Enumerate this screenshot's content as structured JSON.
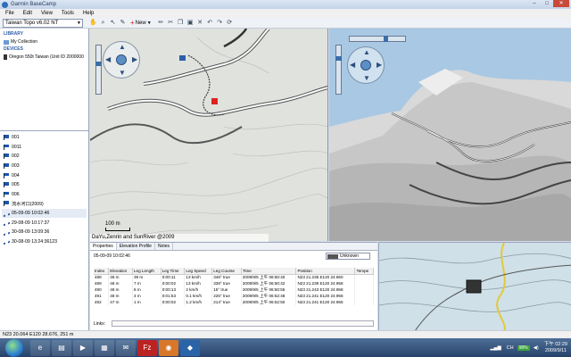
{
  "window": {
    "title": "Garmin BaseCamp",
    "min": "–",
    "max": "□",
    "close": "✕"
  },
  "menu": [
    "File",
    "Edit",
    "View",
    "Tools",
    "Help"
  ],
  "toolbar": {
    "map_product": "Taiwan Topo v6.02 NT",
    "new_label": "New",
    "icons": [
      "hand-icon",
      "magnifier-icon",
      "select-icon",
      "ruler-icon",
      "pencil-icon",
      "scissors-icon",
      "copy-icon",
      "paste-icon",
      "delete-icon",
      "undo-icon",
      "redo-icon",
      "rotate-icon"
    ]
  },
  "library": {
    "header": "LIBRARY",
    "collection": "My Collection",
    "devices_header": "DEVICES",
    "device": "Oregon 550t Taiwan (Unit ID 2000000"
  },
  "items": [
    {
      "type": "waypoint",
      "label": "001"
    },
    {
      "type": "waypoint",
      "label": "0011"
    },
    {
      "type": "waypoint",
      "label": "002"
    },
    {
      "type": "waypoint",
      "label": "003"
    },
    {
      "type": "waypoint",
      "label": "004"
    },
    {
      "type": "waypoint",
      "label": "005"
    },
    {
      "type": "waypoint",
      "label": "006"
    },
    {
      "type": "waypoint",
      "label": "流水河口(2009)"
    },
    {
      "type": "track",
      "label": "05-09-09 10:02:46"
    },
    {
      "type": "track",
      "label": "29-08-09 10:17:37"
    },
    {
      "type": "track",
      "label": "30-08-09 13:09:36"
    },
    {
      "type": "track",
      "label": "30-08-09 13:24:36123"
    }
  ],
  "map": {
    "scale_label": "100 m",
    "credits": "DaYu,Zenrin and SunRiver @2009"
  },
  "properties": {
    "tabs": [
      "Properties",
      "Elevation Profile",
      "Notes"
    ],
    "track_name": "05-09-09 10:02:46",
    "color_label": "Unknown",
    "columns": [
      "Index",
      "Elevation",
      "Leg Length",
      "Leg Time",
      "Leg Speed",
      "Leg Course",
      "Time",
      "Position",
      "Tempe"
    ],
    "rows": [
      [
        "488",
        "48 m",
        "39 m",
        "0:00:11",
        "13 km/h",
        "346° true",
        "2009/9/5 上午 06:50:40",
        "N23 21.235 E120 24.960",
        ""
      ],
      [
        "489",
        "48 m",
        "7 m",
        "0:00:02",
        "13 km/h",
        "338° true",
        "2009/9/5 上午 06:50:42",
        "N23 21.239 E120 24.958",
        ""
      ],
      [
        "490",
        "48 m",
        "8 m",
        "0:00:13",
        "2 km/h",
        "15° true",
        "2009/9/5 上午 06:50:55",
        "N23 21.243 E120 24.958",
        ""
      ],
      [
        "491",
        "48 m",
        "4 m",
        "0:01:53",
        "0.1 km/h",
        "226° true",
        "2009/9/5 上午 06:52:48",
        "N23 21.241 E120 24.956",
        ""
      ],
      [
        "492",
        "47 m",
        "1 m",
        "0:00:02",
        "1.2 km/h",
        "214° true",
        "2009/9/5 上午 06:52:50",
        "N23 21.241 E120 24.955",
        ""
      ]
    ],
    "links_label": "Links:"
  },
  "status": {
    "position": "N23 20.064 E120 28.676, 251 m"
  },
  "taskbar": {
    "apps": [
      "ie-icon",
      "folder-icon",
      "media-icon",
      "clipboard-icon",
      "chat-icon",
      "filezilla-icon",
      "firefox-icon",
      "basecamp-icon"
    ],
    "apps_glyphs": [
      "e",
      "▤",
      "▶",
      "▦",
      "✉",
      "Fz",
      "◉",
      "◆"
    ],
    "lang": "CH",
    "battery": "98%",
    "time": "下午 02:29",
    "date": "2009/9/11"
  },
  "colors": {
    "water": "#a8c8e4",
    "road": "#555555",
    "track": "#3344aa",
    "land": "#dfe2dd"
  }
}
